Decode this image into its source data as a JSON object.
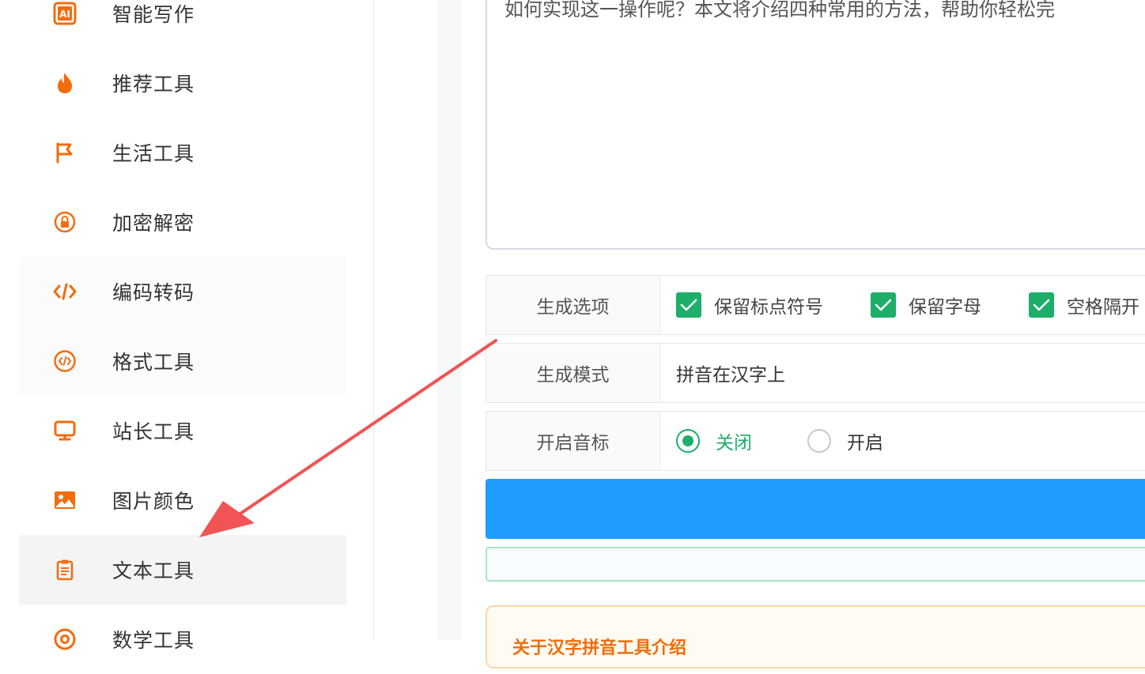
{
  "sidebar": {
    "items": [
      {
        "label": "智能写作",
        "icon": "ai-icon"
      },
      {
        "label": "推荐工具",
        "icon": "flame-icon"
      },
      {
        "label": "生活工具",
        "icon": "flag-icon"
      },
      {
        "label": "加密解密",
        "icon": "lock-icon"
      },
      {
        "label": "编码转码",
        "icon": "code-icon"
      },
      {
        "label": "格式工具",
        "icon": "code-circle-icon"
      },
      {
        "label": "站长工具",
        "icon": "monitor-icon"
      },
      {
        "label": "图片颜色",
        "icon": "image-icon"
      },
      {
        "label": "文本工具",
        "icon": "clipboard-icon"
      },
      {
        "label": "数学工具",
        "icon": "at-icon"
      }
    ],
    "active_index": 8
  },
  "editor": {
    "text": "如何实现这一操作呢？本文将介绍四种常用的方法，帮助你轻松完"
  },
  "options": {
    "generate_options": {
      "label": "生成选项",
      "checkboxes": [
        {
          "label": "保留标点符号",
          "checked": true
        },
        {
          "label": "保留字母",
          "checked": true
        },
        {
          "label": "空格隔开",
          "checked": true
        }
      ]
    },
    "generate_mode": {
      "label": "生成模式",
      "value": "拼音在汉字上"
    },
    "tone_marks": {
      "label": "开启音标",
      "radios": [
        {
          "label": "关闭",
          "selected": true
        },
        {
          "label": "开启",
          "selected": false
        }
      ]
    }
  },
  "info": {
    "title": "关于汉字拼音工具介绍"
  },
  "colors": {
    "accent": "#f36c0b",
    "green": "#1dae6a",
    "blue": "#1e9dff",
    "arrow": "#f05454"
  }
}
